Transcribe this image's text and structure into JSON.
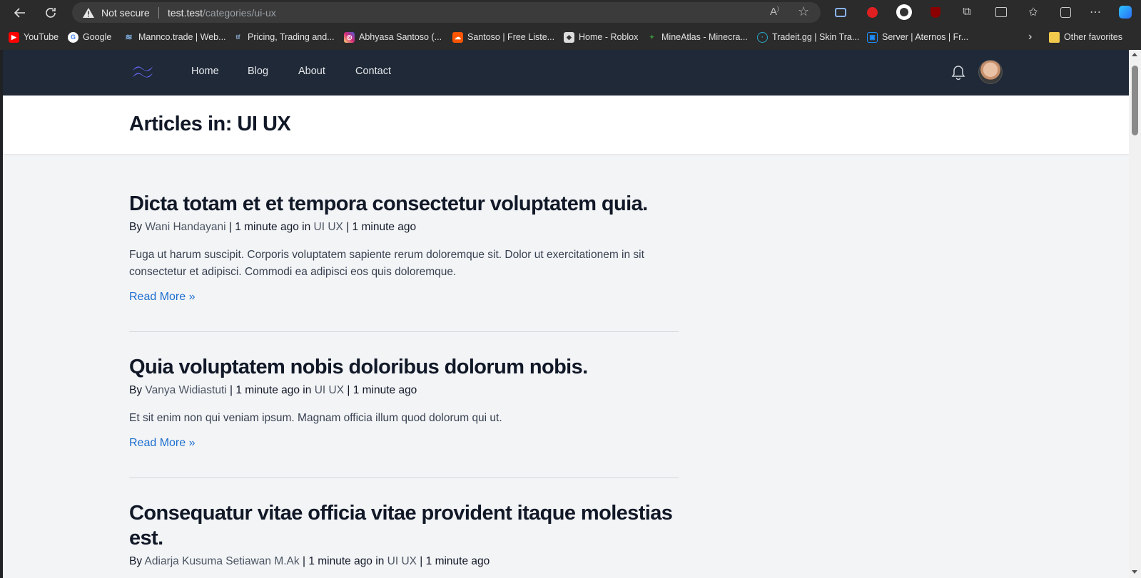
{
  "browser": {
    "security_label": "Not secure",
    "url_host": "test.test",
    "url_path": "/categories/ui-ux",
    "bookmarks": [
      {
        "label": "YouTube",
        "icon": "youtube-icon",
        "color": "#ff0000"
      },
      {
        "label": "Google",
        "icon": "google-icon",
        "color": "#ffffff"
      },
      {
        "label": "Mannco.trade | Web...",
        "icon": "mannco-icon",
        "color": "#7fb0e0"
      },
      {
        "label": "Pricing, Trading and...",
        "icon": "tf-icon",
        "color": "#5b7fa6"
      },
      {
        "label": "Abhyasa Santoso (...",
        "icon": "instagram-icon",
        "color": "#d62976"
      },
      {
        "label": "Santoso | Free Liste...",
        "icon": "soundcloud-icon",
        "color": "#ff5500"
      },
      {
        "label": "Home - Roblox",
        "icon": "roblox-icon",
        "color": "#dddddd"
      },
      {
        "label": "MineAtlas - Minecra...",
        "icon": "mineatlas-icon",
        "color": "#3c8c3c"
      },
      {
        "label": "Tradeit.gg | Skin Tra...",
        "icon": "tradeit-icon",
        "color": "#2aa8c8"
      },
      {
        "label": "Server | Aternos | Fr...",
        "icon": "aternos-icon",
        "color": "#1e90ff"
      }
    ],
    "other_favorites": "Other favorites"
  },
  "site": {
    "nav": {
      "home": "Home",
      "blog": "Blog",
      "about": "About",
      "contact": "Contact"
    },
    "page_title": "Articles in: UI UX",
    "articles": [
      {
        "title": "Dicta totam et et tempora consectetur voluptatem quia.",
        "by": "By",
        "author": "Wani Handayani",
        "sep1": "|",
        "time": "1 minute ago",
        "in": "in",
        "category": "UI UX",
        "sep2": "|",
        "time2": "1 minute ago",
        "excerpt": "Fuga ut harum suscipit. Corporis voluptatem sapiente rerum doloremque sit. Dolor ut exercitationem in sit consectetur et adipisci. Commodi ea adipisci eos quis doloremque.",
        "read_more": "Read More »"
      },
      {
        "title": "Quia voluptatem nobis doloribus dolorum nobis.",
        "by": "By",
        "author": "Vanya Widiastuti",
        "sep1": "|",
        "time": "1 minute ago",
        "in": "in",
        "category": "UI UX",
        "sep2": "|",
        "time2": "1 minute ago",
        "excerpt": "Et sit enim non qui veniam ipsum. Magnam officia illum quod dolorum qui ut.",
        "read_more": "Read More »"
      },
      {
        "title": "Consequatur vitae officia vitae provident itaque molestias est.",
        "by": "By",
        "author": "Adiarja Kusuma Setiawan M.Ak",
        "sep1": "|",
        "time": "1 minute ago",
        "in": "in",
        "category": "UI UX",
        "sep2": "|",
        "time2": "1 minute ago"
      }
    ]
  },
  "colors": {
    "nav_bg": "#1f2937",
    "page_bg": "#f3f4f6",
    "link_blue": "#1d6fce"
  }
}
